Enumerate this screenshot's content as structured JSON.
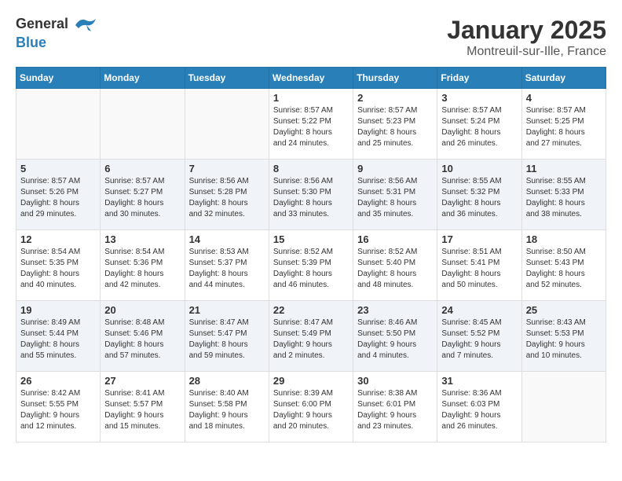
{
  "header": {
    "logo_general": "General",
    "logo_blue": "Blue",
    "month_year": "January 2025",
    "location": "Montreuil-sur-Ille, France"
  },
  "days_of_week": [
    "Sunday",
    "Monday",
    "Tuesday",
    "Wednesday",
    "Thursday",
    "Friday",
    "Saturday"
  ],
  "weeks": [
    [
      {
        "day": "",
        "info": ""
      },
      {
        "day": "",
        "info": ""
      },
      {
        "day": "",
        "info": ""
      },
      {
        "day": "1",
        "info": "Sunrise: 8:57 AM\nSunset: 5:22 PM\nDaylight: 8 hours\nand 24 minutes."
      },
      {
        "day": "2",
        "info": "Sunrise: 8:57 AM\nSunset: 5:23 PM\nDaylight: 8 hours\nand 25 minutes."
      },
      {
        "day": "3",
        "info": "Sunrise: 8:57 AM\nSunset: 5:24 PM\nDaylight: 8 hours\nand 26 minutes."
      },
      {
        "day": "4",
        "info": "Sunrise: 8:57 AM\nSunset: 5:25 PM\nDaylight: 8 hours\nand 27 minutes."
      }
    ],
    [
      {
        "day": "5",
        "info": "Sunrise: 8:57 AM\nSunset: 5:26 PM\nDaylight: 8 hours\nand 29 minutes."
      },
      {
        "day": "6",
        "info": "Sunrise: 8:57 AM\nSunset: 5:27 PM\nDaylight: 8 hours\nand 30 minutes."
      },
      {
        "day": "7",
        "info": "Sunrise: 8:56 AM\nSunset: 5:28 PM\nDaylight: 8 hours\nand 32 minutes."
      },
      {
        "day": "8",
        "info": "Sunrise: 8:56 AM\nSunset: 5:30 PM\nDaylight: 8 hours\nand 33 minutes."
      },
      {
        "day": "9",
        "info": "Sunrise: 8:56 AM\nSunset: 5:31 PM\nDaylight: 8 hours\nand 35 minutes."
      },
      {
        "day": "10",
        "info": "Sunrise: 8:55 AM\nSunset: 5:32 PM\nDaylight: 8 hours\nand 36 minutes."
      },
      {
        "day": "11",
        "info": "Sunrise: 8:55 AM\nSunset: 5:33 PM\nDaylight: 8 hours\nand 38 minutes."
      }
    ],
    [
      {
        "day": "12",
        "info": "Sunrise: 8:54 AM\nSunset: 5:35 PM\nDaylight: 8 hours\nand 40 minutes."
      },
      {
        "day": "13",
        "info": "Sunrise: 8:54 AM\nSunset: 5:36 PM\nDaylight: 8 hours\nand 42 minutes."
      },
      {
        "day": "14",
        "info": "Sunrise: 8:53 AM\nSunset: 5:37 PM\nDaylight: 8 hours\nand 44 minutes."
      },
      {
        "day": "15",
        "info": "Sunrise: 8:52 AM\nSunset: 5:39 PM\nDaylight: 8 hours\nand 46 minutes."
      },
      {
        "day": "16",
        "info": "Sunrise: 8:52 AM\nSunset: 5:40 PM\nDaylight: 8 hours\nand 48 minutes."
      },
      {
        "day": "17",
        "info": "Sunrise: 8:51 AM\nSunset: 5:41 PM\nDaylight: 8 hours\nand 50 minutes."
      },
      {
        "day": "18",
        "info": "Sunrise: 8:50 AM\nSunset: 5:43 PM\nDaylight: 8 hours\nand 52 minutes."
      }
    ],
    [
      {
        "day": "19",
        "info": "Sunrise: 8:49 AM\nSunset: 5:44 PM\nDaylight: 8 hours\nand 55 minutes."
      },
      {
        "day": "20",
        "info": "Sunrise: 8:48 AM\nSunset: 5:46 PM\nDaylight: 8 hours\nand 57 minutes."
      },
      {
        "day": "21",
        "info": "Sunrise: 8:47 AM\nSunset: 5:47 PM\nDaylight: 8 hours\nand 59 minutes."
      },
      {
        "day": "22",
        "info": "Sunrise: 8:47 AM\nSunset: 5:49 PM\nDaylight: 9 hours\nand 2 minutes."
      },
      {
        "day": "23",
        "info": "Sunrise: 8:46 AM\nSunset: 5:50 PM\nDaylight: 9 hours\nand 4 minutes."
      },
      {
        "day": "24",
        "info": "Sunrise: 8:45 AM\nSunset: 5:52 PM\nDaylight: 9 hours\nand 7 minutes."
      },
      {
        "day": "25",
        "info": "Sunrise: 8:43 AM\nSunset: 5:53 PM\nDaylight: 9 hours\nand 10 minutes."
      }
    ],
    [
      {
        "day": "26",
        "info": "Sunrise: 8:42 AM\nSunset: 5:55 PM\nDaylight: 9 hours\nand 12 minutes."
      },
      {
        "day": "27",
        "info": "Sunrise: 8:41 AM\nSunset: 5:57 PM\nDaylight: 9 hours\nand 15 minutes."
      },
      {
        "day": "28",
        "info": "Sunrise: 8:40 AM\nSunset: 5:58 PM\nDaylight: 9 hours\nand 18 minutes."
      },
      {
        "day": "29",
        "info": "Sunrise: 8:39 AM\nSunset: 6:00 PM\nDaylight: 9 hours\nand 20 minutes."
      },
      {
        "day": "30",
        "info": "Sunrise: 8:38 AM\nSunset: 6:01 PM\nDaylight: 9 hours\nand 23 minutes."
      },
      {
        "day": "31",
        "info": "Sunrise: 8:36 AM\nSunset: 6:03 PM\nDaylight: 9 hours\nand 26 minutes."
      },
      {
        "day": "",
        "info": ""
      }
    ]
  ]
}
